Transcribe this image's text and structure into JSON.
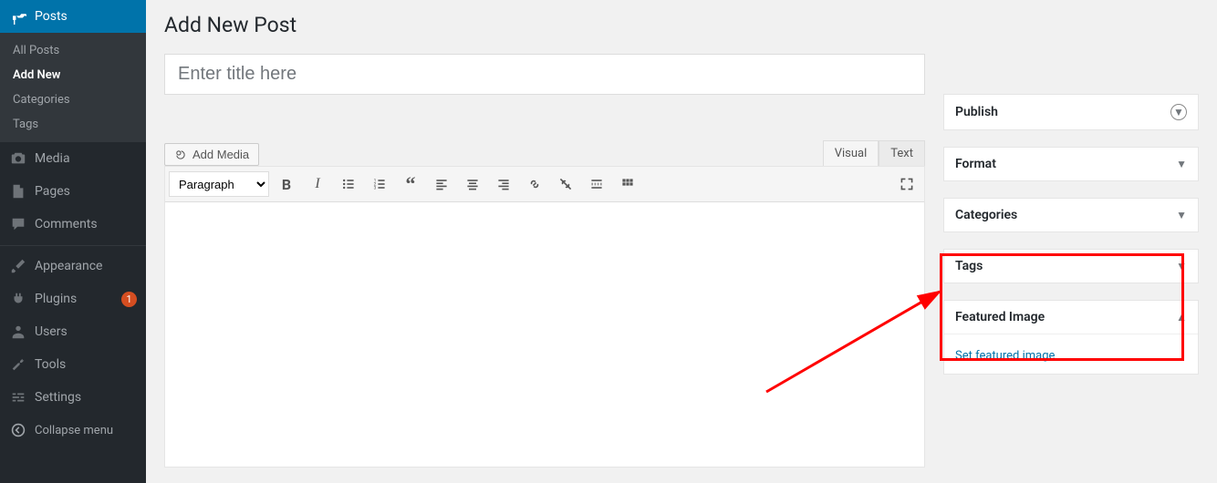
{
  "sidebar": {
    "posts_label": "Posts",
    "sub": {
      "all": "All Posts",
      "add": "Add New",
      "cat": "Categories",
      "tags": "Tags"
    },
    "media": "Media",
    "pages": "Pages",
    "comments": "Comments",
    "appearance": "Appearance",
    "plugins": "Plugins",
    "plugins_badge": "1",
    "users": "Users",
    "tools": "Tools",
    "settings": "Settings",
    "collapse": "Collapse menu"
  },
  "page": {
    "title": "Add New Post"
  },
  "title_input": {
    "placeholder": "Enter title here"
  },
  "media_button": "Add Media",
  "editor_tabs": {
    "visual": "Visual",
    "text": "Text"
  },
  "toolbar": {
    "paragraph": "Paragraph"
  },
  "meta": {
    "publish": "Publish",
    "format": "Format",
    "categories": "Categories",
    "tags": "Tags",
    "featured": "Featured Image",
    "set_featured": "Set featured image"
  }
}
